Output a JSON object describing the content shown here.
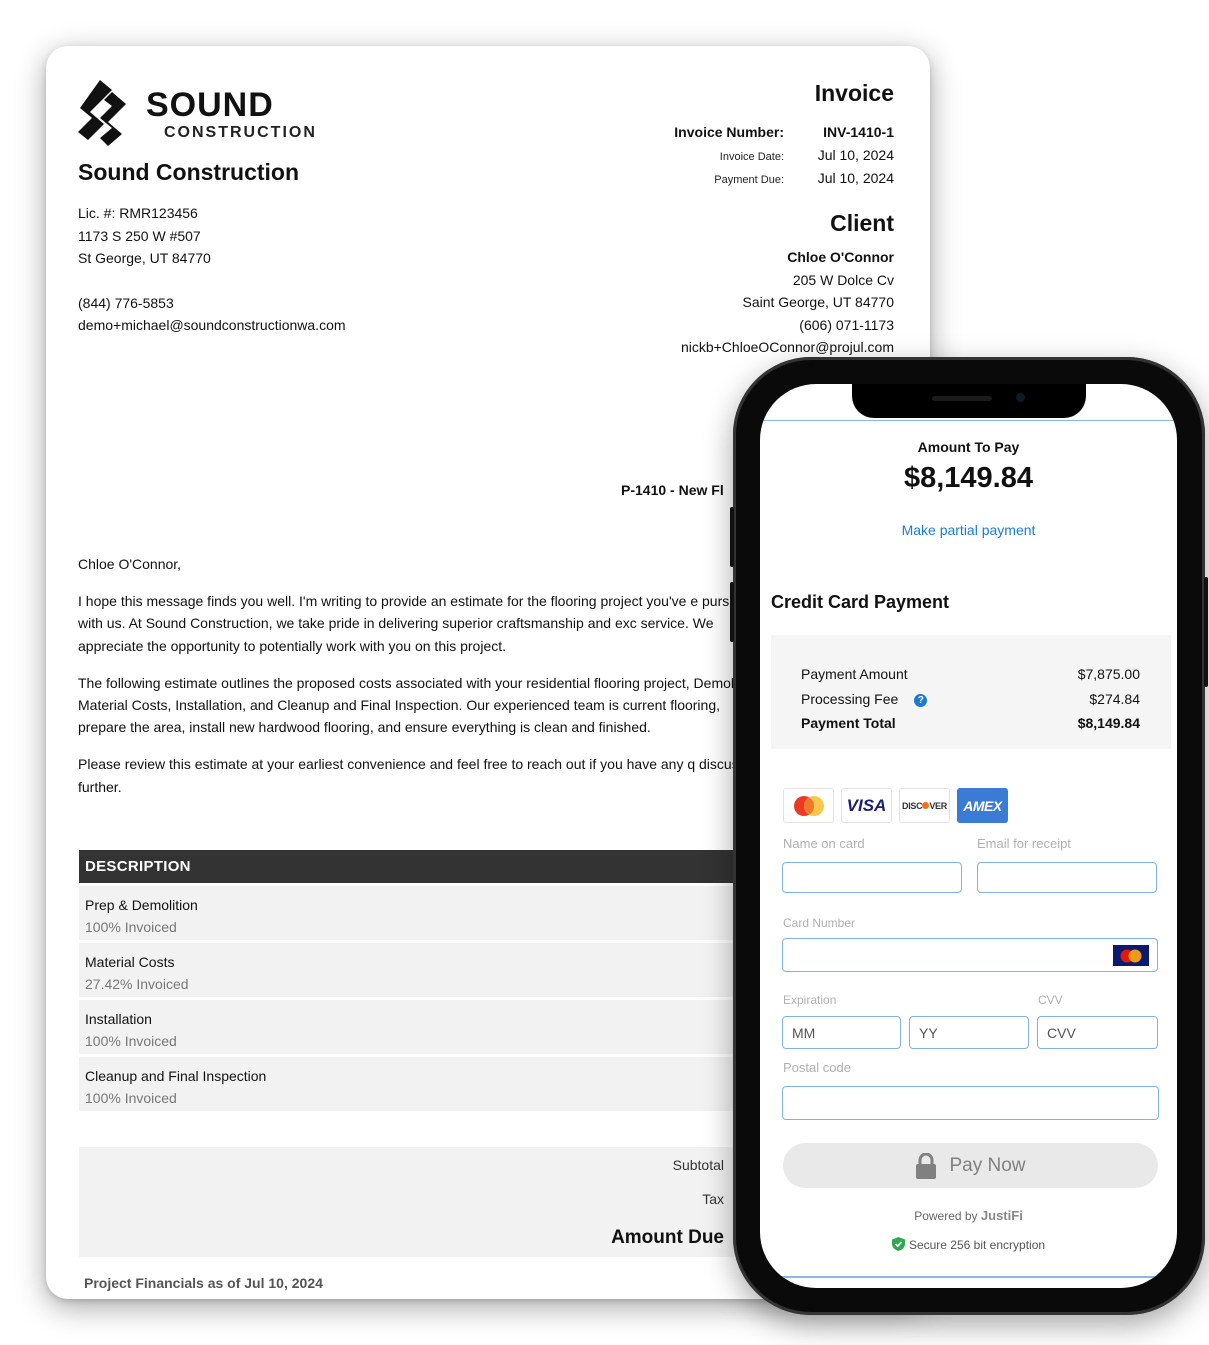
{
  "invoice": {
    "company": {
      "logo_word": "SOUND",
      "logo_sub": "CONSTRUCTION",
      "name": "Sound Construction",
      "license": "Lic. #: RMR123456",
      "address1": "1173 S 250 W #507",
      "address2": "St George, UT 84770",
      "phone": "(844) 776-5853",
      "email": "demo+michael@soundconstructionwa.com"
    },
    "title": "Invoice",
    "meta": [
      {
        "label": "Invoice Number:",
        "value": "INV-1410-1"
      },
      {
        "label": "Invoice Date:",
        "value": "Jul 10, 2024"
      },
      {
        "label": "Payment Due:",
        "value": "Jul 10, 2024"
      }
    ],
    "client": {
      "heading": "Client",
      "name": "Chloe O'Connor",
      "address1": "205 W Dolce Cv",
      "address2": "Saint George, UT 84770",
      "phone": "(606) 071-1173",
      "email": "nickb+ChloeOConnor@projul.com"
    },
    "project_title": "P-1410 - New Fl",
    "letter": {
      "greeting": "Chloe O'Connor,",
      "p1": "I hope this message finds you well. I'm writing to provide an estimate for the flooring project you've e pursuing with us. At Sound Construction, we take pride in delivering superior craftsmanship and exc service. We appreciate the opportunity to potentially work with you on this project.",
      "p2": "The following estimate outlines the proposed costs associated with your residential flooring project, Demolition, Material Costs, Installation, and Cleanup and Final Inspection. Our experienced team is current flooring, prepare the area, install new hardwood flooring, and ensure everything is clean and finished.",
      "p3": "Please review this estimate at your earliest convenience and feel free to reach out if you have any q discuss further."
    },
    "table": {
      "header": "DESCRIPTION",
      "rows": [
        {
          "title": "Prep & Demolition",
          "status": "100% Invoiced"
        },
        {
          "title": "Material Costs",
          "status": "27.42% Invoiced"
        },
        {
          "title": "Installation",
          "status": "100% Invoiced"
        },
        {
          "title": "Cleanup and Final Inspection",
          "status": "100% Invoiced"
        }
      ]
    },
    "totals": {
      "subtotal_label": "Subtotal",
      "tax_label": "Tax",
      "amount_due_label": "Amount Due"
    },
    "financials": "Project Financials as of Jul 10, 2024"
  },
  "payment": {
    "amount_label": "Amount To Pay",
    "amount": "$8,149.84",
    "partial_link": "Make partial payment",
    "section_title": "Credit Card Payment",
    "summary": {
      "payment_amount_label": "Payment Amount",
      "payment_amount": "$7,875.00",
      "fee_label": "Processing Fee",
      "fee": "$274.84",
      "total_label": "Payment Total",
      "total": "$8,149.84"
    },
    "card_brands": [
      "Mastercard",
      "VISA",
      "DISCOVER",
      "AMEX"
    ],
    "fields": {
      "name_label": "Name on card",
      "email_label": "Email for receipt",
      "card_label": "Card Number",
      "expiration_label": "Expiration",
      "cvv_label": "CVV",
      "mm_placeholder": "MM",
      "yy_placeholder": "YY",
      "cvv_placeholder": "CVV",
      "postal_label": "Postal code"
    },
    "pay_button": "Pay Now",
    "powered_by": "Powered by",
    "powered_brand": "JustiFi",
    "secure_text": "Secure 256 bit encryption",
    "colors": {
      "link": "#1a7bd6",
      "input_border": "#7fb2e5",
      "amex": "#3a7bd5",
      "secure": "#2fa84f"
    }
  }
}
